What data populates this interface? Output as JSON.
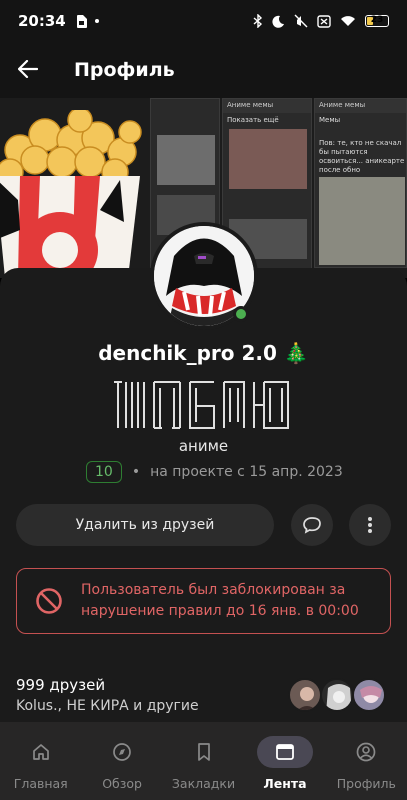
{
  "status_bar": {
    "time": "20:34",
    "battery": "23"
  },
  "header": {
    "title": "Профиль"
  },
  "banner": {
    "cards": [
      {
        "header": "Аниме мемы",
        "sub": "Показать ещё"
      },
      {
        "header": "Аниме мемы",
        "sub": "Мемы",
        "caption": "Пов: те, кто не скачал бы пытаются освоиться... аникеарте после обно"
      }
    ]
  },
  "profile": {
    "username": "denchik_pro 2.0 🎄",
    "bio": "аниме",
    "level": "10",
    "joined": "на проекте с 15 апр. 2023"
  },
  "actions": {
    "unfriend": "Удалить из друзей"
  },
  "ban_notice": {
    "text_line1": "Пользователь был заблокирован за",
    "text_line2": "нарушение правил до 16 янв. в 00:00"
  },
  "friends": {
    "count": "999 друзей",
    "names": "Kolus., НЕ КИРА и другие"
  },
  "nav": {
    "items": [
      {
        "label": "Главная",
        "icon": "home-icon"
      },
      {
        "label": "Обзор",
        "icon": "compass-icon"
      },
      {
        "label": "Закладки",
        "icon": "bookmark-icon"
      },
      {
        "label": "Лента",
        "icon": "feed-icon"
      },
      {
        "label": "Профиль",
        "icon": "profile-icon"
      }
    ],
    "active": "Лента"
  }
}
